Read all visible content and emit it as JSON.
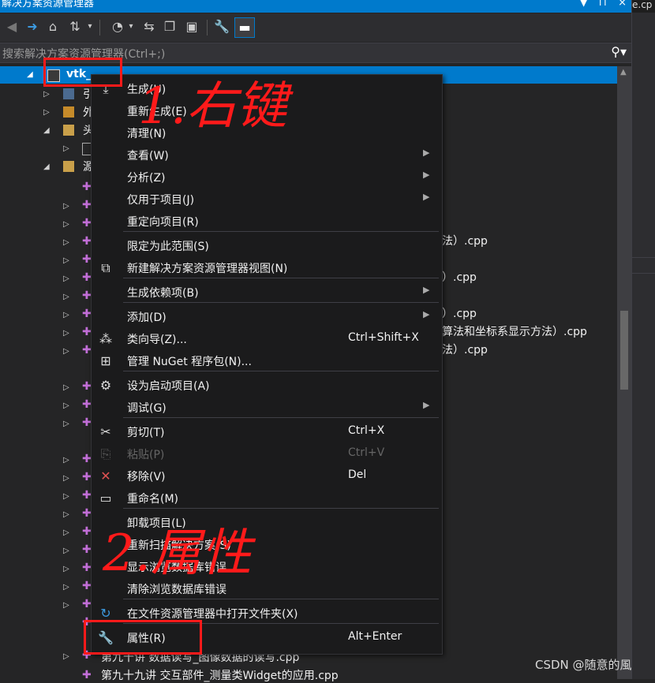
{
  "window": {
    "title": "解决方案资源管理器",
    "side_tab": "e.cp",
    "buttons": [
      "▼",
      "⊓",
      "×"
    ]
  },
  "search": {
    "placeholder": "搜索解决方案资源管理器(Ctrl+;)"
  },
  "tree": {
    "project": "vtk_",
    "row_labels": {
      "references": "引",
      "external": "外",
      "headers": "头",
      "source": "源"
    },
    "file_fragments": [
      "法）.cpp",
      "）.cpp",
      "）.cpp",
      "算法和坐标系显示方法）.cpp",
      "法）.cpp"
    ],
    "bottom_items": [
      "第九十讲 数据读写_图像数据的读写.cpp",
      "第九十九讲 交互部件_测量类Widget的应用.cpp"
    ]
  },
  "context_menu": {
    "items": [
      {
        "label": "生成(U)",
        "icon": "build-icon"
      },
      {
        "label": "重新生成(E)"
      },
      {
        "label": "清理(N)"
      },
      {
        "label": "查看(W)",
        "submenu": true
      },
      {
        "label": "分析(Z)",
        "submenu": true
      },
      {
        "label": "仅用于项目(J)",
        "submenu": true
      },
      {
        "label": "重定向项目(R)"
      },
      {
        "label": "限定为此范围(S)"
      },
      {
        "label": "新建解决方案资源管理器视图(N)",
        "icon": "new-view-icon"
      },
      {
        "label": "生成依赖项(B)",
        "submenu": true
      },
      {
        "label": "添加(D)",
        "submenu": true
      },
      {
        "label": "类向导(Z)...",
        "shortcut": "Ctrl+Shift+X",
        "icon": "class-wizard-icon"
      },
      {
        "label": "管理 NuGet 程序包(N)...",
        "icon": "nuget-icon"
      },
      {
        "label": "设为启动项目(A)",
        "icon": "gear-icon"
      },
      {
        "label": "调试(G)",
        "submenu": true
      },
      {
        "label": "剪切(T)",
        "shortcut": "Ctrl+X",
        "icon": "scissors-icon"
      },
      {
        "label": "粘贴(P)",
        "shortcut": "Ctrl+V",
        "disabled": true,
        "icon": "paste-icon"
      },
      {
        "label": "移除(V)",
        "shortcut": "Del",
        "icon": "remove-icon"
      },
      {
        "label": "重命名(M)",
        "icon": "rename-icon"
      },
      {
        "label": "卸载项目(L)"
      },
      {
        "label": "重新扫描解决方案(S)"
      },
      {
        "label": "显示浏览数据库错误"
      },
      {
        "label": "清除浏览数据库错误"
      },
      {
        "label": "在文件资源管理器中打开文件夹(X)",
        "icon": "refresh-folder-icon"
      },
      {
        "label": "属性(R)",
        "shortcut": "Alt+Enter",
        "icon": "wrench-icon"
      }
    ]
  },
  "annotations": {
    "step1": "1.右键",
    "step2": "2.属性",
    "color": "#ff1a1a"
  },
  "watermark": "CSDN @随意的風"
}
